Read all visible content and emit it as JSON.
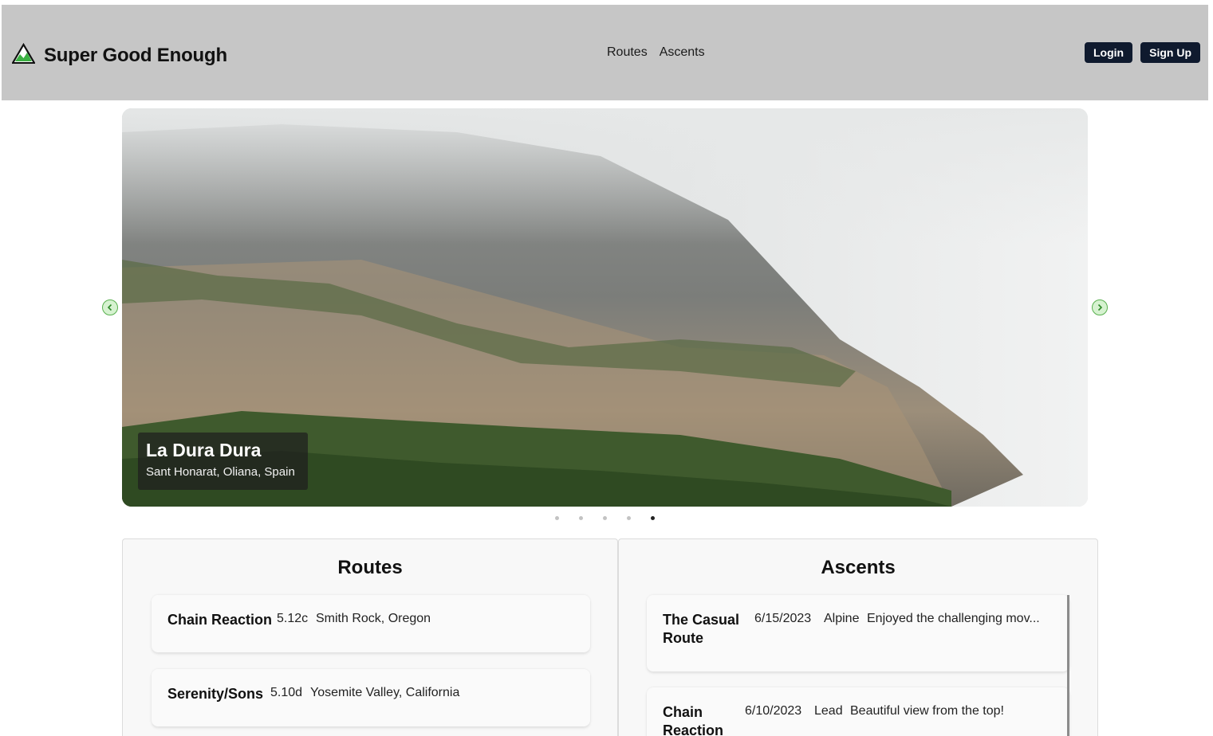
{
  "header": {
    "brand": "Super Good Enough",
    "nav": [
      "Routes",
      "Ascents"
    ],
    "login": "Login",
    "signup": "Sign Up"
  },
  "carousel": {
    "title": "La Dura Dura",
    "subtitle": "Sant Honarat, Oliana, Spain",
    "slide_count": 5,
    "active_slide": 5
  },
  "routes": {
    "title": "Routes",
    "items": [
      {
        "name": "Chain Reaction",
        "grade": "5.12c",
        "location": "Smith Rock, Oregon"
      },
      {
        "name": "Serenity/Sons",
        "grade": "5.10d",
        "location": "Yosemite Valley, California"
      }
    ]
  },
  "ascents": {
    "title": "Ascents",
    "items": [
      {
        "name": "The Casual Route",
        "date": "6/15/2023",
        "style": "Alpine",
        "note": "Enjoyed the challenging mov..."
      },
      {
        "name": "Chain Reaction",
        "date": "6/10/2023",
        "style": "Lead",
        "note": "Beautiful view from the top!"
      }
    ]
  },
  "colors": {
    "navbar": "#c6c6c6",
    "button": "#0f1a2e",
    "arrow": "#58b04e"
  },
  "icons": {
    "brand": "mountain-icon",
    "prev": "chevron-left-icon",
    "next": "chevron-right-icon"
  }
}
